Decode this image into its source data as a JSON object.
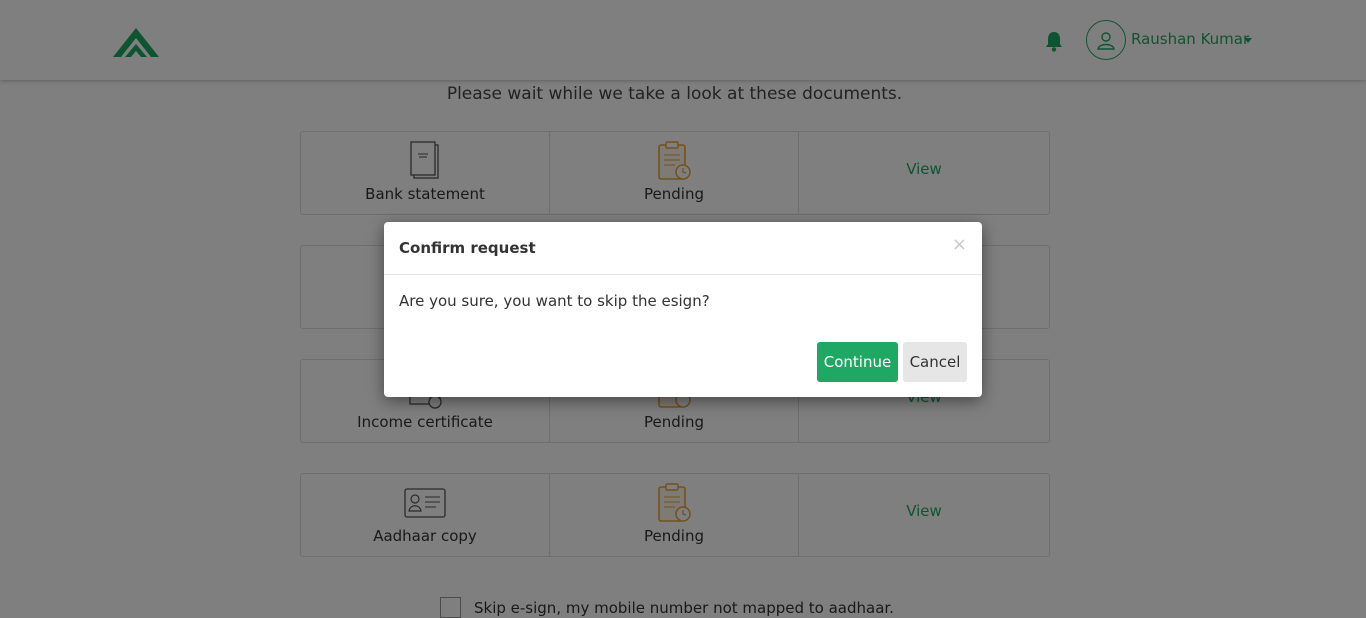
{
  "header": {
    "user_name": "Raushan Kumar"
  },
  "colors": {
    "brand_green": "#1ea863",
    "pending_orange": "#e8a23a"
  },
  "main": {
    "wait_message": "Please wait while we take a look at these documents.",
    "documents": [
      {
        "label": "Bank statement",
        "status": "Pending",
        "action": "View",
        "icon": "bank-statement-icon"
      },
      {
        "label": "",
        "status": "",
        "action": "",
        "icon": "document-icon"
      },
      {
        "label": "Income certificate",
        "status": "Pending",
        "action": "View",
        "icon": "income-certificate-icon"
      },
      {
        "label": "Aadhaar copy",
        "status": "Pending",
        "action": "View",
        "icon": "id-card-icon"
      }
    ],
    "skip_esign_label": "Skip e-sign, my mobile number not mapped to aadhaar."
  },
  "modal": {
    "title": "Confirm request",
    "close_symbol": "×",
    "message": "Are you sure, you want to skip the esign?",
    "continue_label": "Continue",
    "cancel_label": "Cancel"
  }
}
